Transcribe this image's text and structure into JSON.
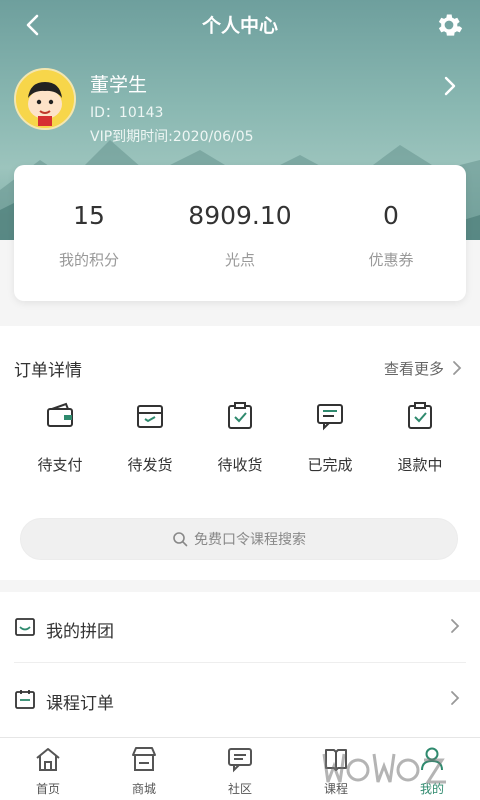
{
  "header": {
    "title": "个人中心"
  },
  "profile": {
    "name": "董学生",
    "id_text": "ID：10143",
    "vip_text": "VIP到期时间:2020/06/05"
  },
  "stats": [
    {
      "value": "15",
      "label": "我的积分"
    },
    {
      "value": "8909.10",
      "label": "光点"
    },
    {
      "value": "0",
      "label": "优惠券"
    }
  ],
  "orders": {
    "title": "订单详情",
    "view_more": "查看更多",
    "items": [
      {
        "label": "待支付",
        "icon": "wallet-icon"
      },
      {
        "label": "待发货",
        "icon": "box-icon"
      },
      {
        "label": "待收货",
        "icon": "clipboard-check-icon"
      },
      {
        "label": "已完成",
        "icon": "message-list-icon"
      },
      {
        "label": "退款中",
        "icon": "clipboard-refund-icon"
      }
    ]
  },
  "search": {
    "placeholder": "免费口令课程搜索"
  },
  "menu": [
    {
      "label": "我的拼团",
      "icon": "bag-icon"
    },
    {
      "label": "课程订单",
      "icon": "calendar-icon"
    }
  ],
  "tabbar": [
    {
      "label": "首页",
      "icon": "home-icon"
    },
    {
      "label": "商城",
      "icon": "store-icon"
    },
    {
      "label": "社区",
      "icon": "chat-icon"
    },
    {
      "label": "课程",
      "icon": "book-icon"
    },
    {
      "label": "我的",
      "icon": "user-icon"
    }
  ],
  "colors": {
    "accent": "#2f8a6e",
    "header_teal": "#7aa8a2"
  }
}
